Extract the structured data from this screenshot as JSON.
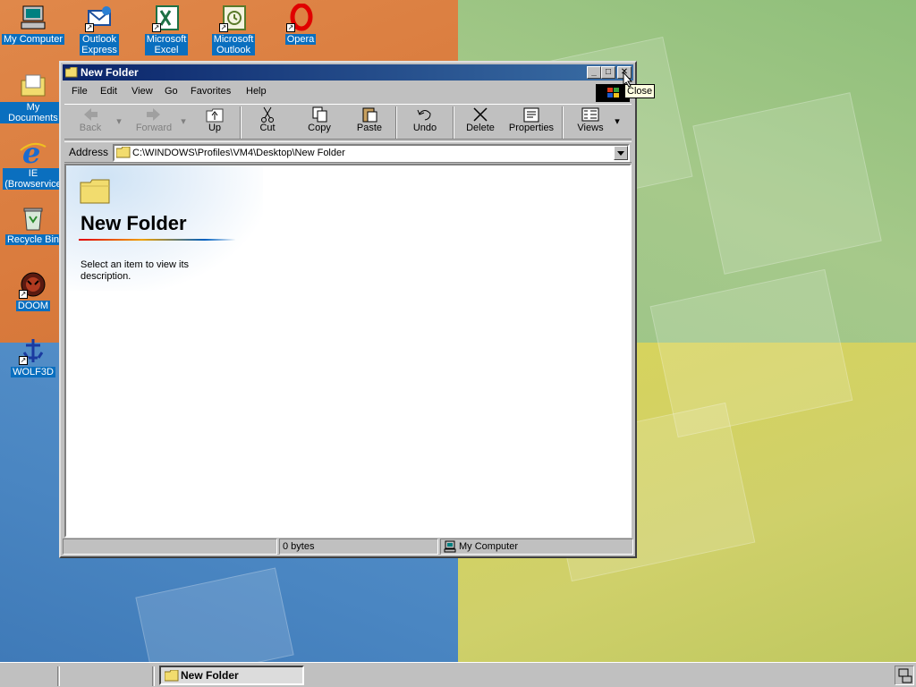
{
  "desktop": {
    "icons": [
      {
        "label_line1": "My Computer",
        "label_line2": "",
        "icon": "computer-icon"
      },
      {
        "label_line1": "Outlook",
        "label_line2": "Express",
        "icon": "outlook-express-icon"
      },
      {
        "label_line1": "Microsoft",
        "label_line2": "Excel",
        "icon": "excel-icon"
      },
      {
        "label_line1": "Microsoft",
        "label_line2": "Outlook",
        "icon": "outlook-icon"
      },
      {
        "label_line1": "Opera",
        "label_line2": "",
        "icon": "opera-icon"
      },
      {
        "label_line1": "My Documents",
        "label_line2": "",
        "icon": "documents-folder-icon"
      },
      {
        "label_line1": "IE",
        "label_line2": "(Browservice",
        "icon": "internet-explorer-icon"
      },
      {
        "label_line1": "Recycle Bin",
        "label_line2": "",
        "icon": "recycle-bin-icon"
      },
      {
        "label_line1": "DOOM",
        "label_line2": "",
        "icon": "doom-icon"
      },
      {
        "label_line1": "WOLF3D",
        "label_line2": "",
        "icon": "wolf3d-icon"
      }
    ]
  },
  "window": {
    "title": "New Folder",
    "menu": [
      "File",
      "Edit",
      "View",
      "Go",
      "Favorites",
      "Help"
    ],
    "toolbar": {
      "back": "Back",
      "forward": "Forward",
      "up": "Up",
      "cut": "Cut",
      "copy": "Copy",
      "paste": "Paste",
      "undo": "Undo",
      "delete": "Delete",
      "properties": "Properties",
      "views": "Views"
    },
    "address": {
      "label": "Address",
      "value": "C:\\WINDOWS\\Profiles\\VM4\\Desktop\\New Folder"
    },
    "content": {
      "folder_title": "New Folder",
      "description": "Select an item to view its description."
    },
    "status": {
      "left": "",
      "size": "0 bytes",
      "location": "My Computer"
    }
  },
  "tooltip": "Close",
  "taskbar": {
    "task_title": "New Folder"
  },
  "colors": {
    "title_active": "#0a246a",
    "desktop_label_bg": "#0a6fbf"
  }
}
